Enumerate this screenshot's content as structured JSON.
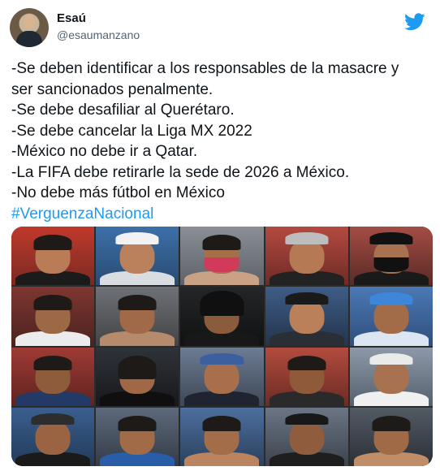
{
  "tweet": {
    "author_name": "Esaú",
    "author_handle": "@esaumanzano",
    "lines": [
      "-Se deben identificar a los responsables de la masacre y",
      "ser sancionados penalmente.",
      "-Se debe desafiliar al Querétaro.",
      "-Se debe cancelar la Liga MX 2022",
      "-México no debe ir a Qatar.",
      "-La FIFA debe retirarle la sede de 2026 a México.",
      "-No debe más fútbol en México"
    ],
    "hashtag": "#VerguenzaNacional"
  },
  "icons": {
    "brand": "twitter-bird-icon"
  },
  "colors": {
    "brand_blue": "#1d9bf0",
    "text": "#0f1419",
    "muted": "#536471"
  }
}
